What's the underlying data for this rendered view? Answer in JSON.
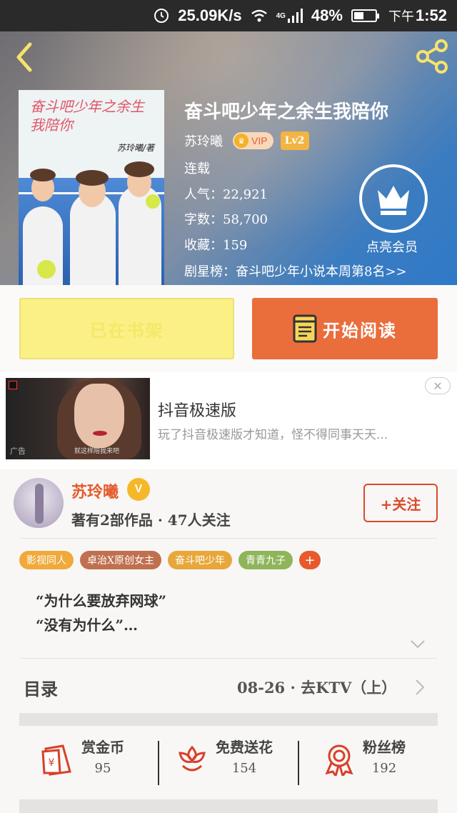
{
  "status_bar": {
    "net_speed": "25.09K/s",
    "network": "4G",
    "battery": "48%",
    "battery_level": 0.48,
    "time_prefix": "下午",
    "time": "1:52"
  },
  "book": {
    "cover_title": "奋斗吧少年之余生我陪你",
    "cover_author": "苏玲曦/著",
    "title": "奋斗吧少年之余生我陪你",
    "author": "苏玲曦",
    "vip": "VIP",
    "level": "Lv2",
    "status": "连载",
    "popularity": "人气：22,921",
    "word_count": "字数：58,700",
    "favorites": "收藏：159",
    "ranking": "剧星榜：奋斗吧少年小说本周第8名>>",
    "member_label": "点亮会员"
  },
  "actions": {
    "shelf_label": "已在书架",
    "read_label": "开始阅读"
  },
  "ad": {
    "title": "抖音极速版",
    "desc": "玩了抖音极速版才知道，怪不得同事天天...",
    "tag": "广告",
    "caption": "就这样陪我来吧",
    "close": "✕"
  },
  "author": {
    "name": "苏玲曦",
    "v": "V",
    "stats": "著有2部作品 · 47人关注",
    "follow_label": "+关注",
    "tags": [
      {
        "label": "影视同人",
        "color": "#f0a93a"
      },
      {
        "label": "卓治X原创女主",
        "color": "#c0704f"
      },
      {
        "label": "奋斗吧少年",
        "color": "#e8a73a"
      },
      {
        "label": "青青九子",
        "color": "#8fb55a"
      }
    ],
    "tag_more": "+",
    "intro_lines": [
      "“为什么要放弃网球”",
      "“没有为什么”…"
    ]
  },
  "toc": {
    "label": "目录",
    "latest": "08-26 · 去KTV（上）"
  },
  "stats": [
    {
      "label": "赏金币",
      "value": "95",
      "icon": "red-envelope-icon"
    },
    {
      "label": "免费送花",
      "value": "154",
      "icon": "flower-icon"
    },
    {
      "label": "粉丝榜",
      "value": "192",
      "icon": "medal-icon"
    }
  ],
  "colors": {
    "accent": "#ea6d3c",
    "shelf": "#faf086",
    "follow": "#d94a2d"
  }
}
